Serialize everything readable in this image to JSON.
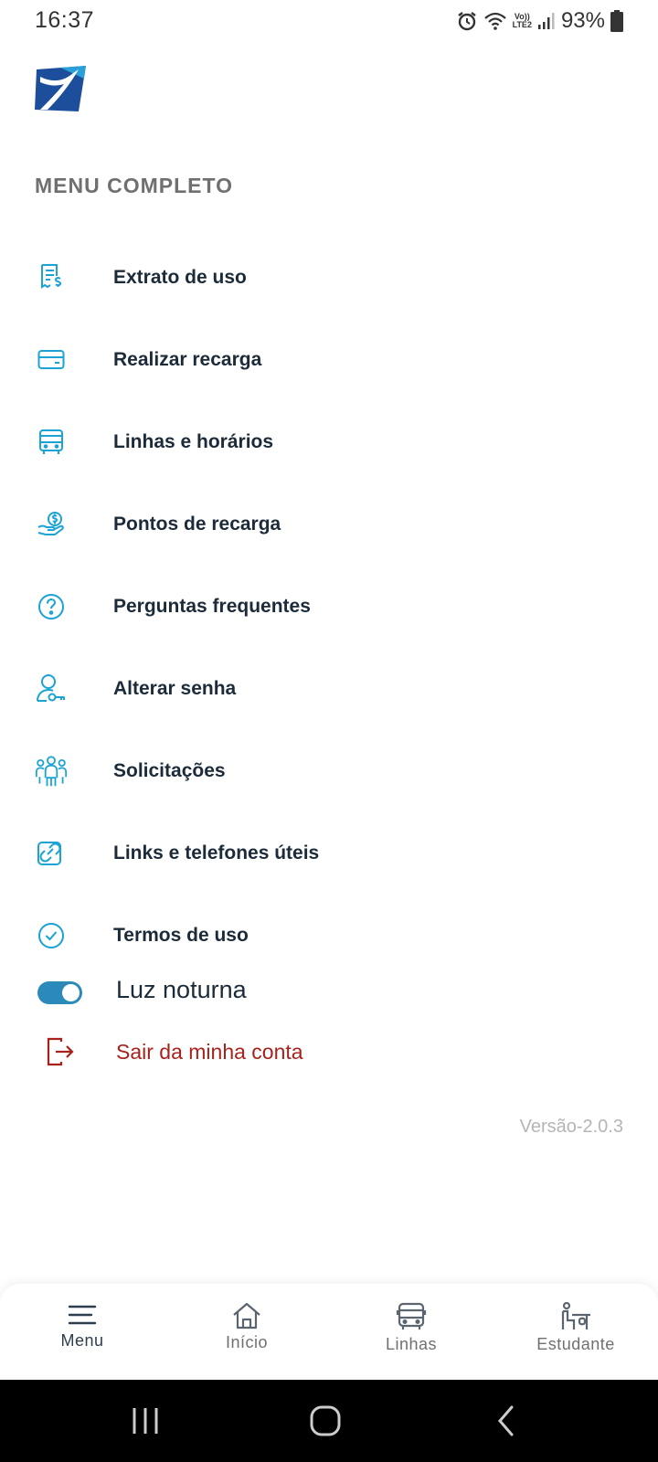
{
  "status_bar": {
    "time": "16:37",
    "network_label_top": "Vo))",
    "network_label_bottom": "LTE2",
    "battery": "93%"
  },
  "section": {
    "title": "MENU COMPLETO"
  },
  "menu": {
    "items": [
      {
        "label": "Extrato de uso",
        "icon": "receipt-icon"
      },
      {
        "label": "Realizar recarga",
        "icon": "credit-card-icon"
      },
      {
        "label": "Linhas e horários",
        "icon": "bus-icon"
      },
      {
        "label": "Pontos de recarga",
        "icon": "hand-coin-icon"
      },
      {
        "label": "Perguntas frequentes",
        "icon": "question-circle-icon"
      },
      {
        "label": "Alterar senha",
        "icon": "user-key-icon"
      },
      {
        "label": "Solicitações",
        "icon": "group-icon"
      },
      {
        "label": "Links e telefones úteis",
        "icon": "link-icon"
      },
      {
        "label": "Termos de uso",
        "icon": "check-circle-icon"
      }
    ]
  },
  "toggle": {
    "label": "Luz noturna",
    "on": true
  },
  "logout": {
    "label": "Sair da minha conta"
  },
  "version": "Versão-2.0.3",
  "bottom_nav": {
    "items": [
      {
        "label": "Menu",
        "icon": "hamburger-icon",
        "active": true
      },
      {
        "label": "Início",
        "icon": "home-icon"
      },
      {
        "label": "Linhas",
        "icon": "bus-icon"
      },
      {
        "label": "Estudante",
        "icon": "student-desk-icon"
      }
    ]
  },
  "colors": {
    "accent": "#1ba3d6",
    "toggle": "#2b8ab9",
    "logout": "#a8221b",
    "text": "#1c2b39",
    "logo_dark": "#1d4e9c",
    "logo_light": "#2b9fd9"
  }
}
